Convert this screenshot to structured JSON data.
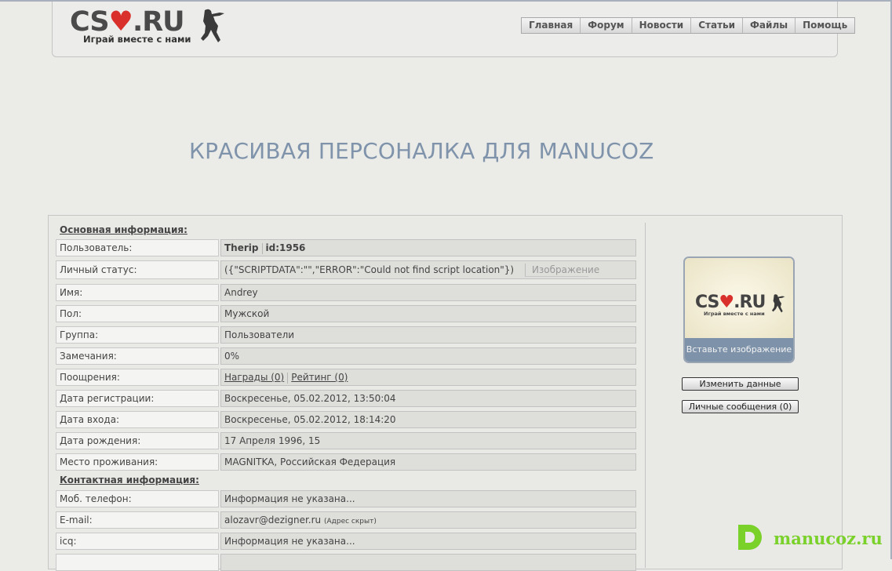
{
  "header": {
    "logo_text_a": "CS",
    "logo_text_b": ".RU",
    "logo_slogan": "Играй вместе с нами",
    "nav": [
      "Главная",
      "Форум",
      "Новости",
      "Статьи",
      "Файлы",
      "Помощь"
    ]
  },
  "page_title": "КРАСИВАЯ ПЕРСОНАЛКА ДЛЯ MANUCOZ",
  "profile": {
    "basic_head": "Основная информация:",
    "contact_head": "Контактная информация:",
    "user_label": "Пользователь:",
    "user_name": "Therip",
    "user_id": "id:1956",
    "status_label": "Личный статус:",
    "status_value": "({\"SCRIPTDATA\":\"\",\"ERROR\":\"Could not find script location\"})",
    "status_image_placeholder": "Изображение",
    "name_label": "Имя:",
    "name_value": "Andrey",
    "gender_label": "Пол:",
    "gender_value": "Мужской",
    "group_label": "Группа:",
    "group_value": "Пользователи",
    "warnings_label": "Замечания:",
    "warnings_value": "0%",
    "rewards_label": "Поощрения:",
    "rewards_link": "Награды (0)",
    "rating_link": "Рейтинг (0)",
    "reg_label": "Дата регистрации:",
    "reg_value": "Воскресенье, 05.02.2012, 13:50:04",
    "login_label": "Дата входа:",
    "login_value": "Воскресенье, 05.02.2012, 18:14:20",
    "birth_label": "Дата рождения:",
    "birth_value": "17 Апреля 1996, 15",
    "location_label": "Место проживания:",
    "location_value": "MAGNITKA, Российская Федерация",
    "phone_label": "Моб. телефон:",
    "phone_value": "Информация не указана...",
    "email_label": "E-mail:",
    "email_value": "alozavr@dezigner.ru",
    "email_note": "(Адрес скрыт)",
    "icq_label": "icq:",
    "icq_value": "Информация не указана..."
  },
  "sidebar": {
    "avatar_logo_a": "CS",
    "avatar_logo_b": ".RU",
    "avatar_slogan": "Играй вместе с нами",
    "avatar_caption": "Вставьте изображение",
    "edit_button": "Изменить данные",
    "messages_button": "Личные сообщения (0)"
  },
  "brand": {
    "text": "manucoz.ru"
  },
  "colors": {
    "title": "#7f93ab",
    "heart": "#d9302c",
    "brand": "#7ad12a",
    "avatar_bar": "#7e93aa"
  }
}
